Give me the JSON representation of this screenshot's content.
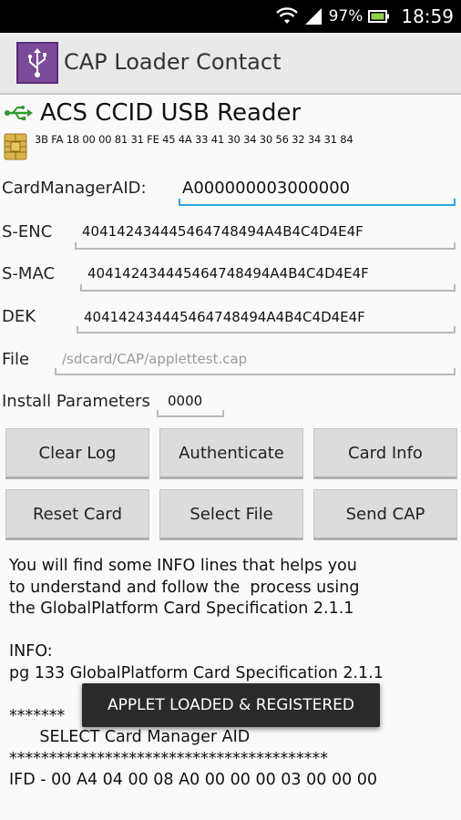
{
  "status_bar": {
    "battery_percent": "97%",
    "time": "18:59"
  },
  "app": {
    "title": "CAP Loader Contact"
  },
  "reader": {
    "name": "ACS CCID USB Reader",
    "atr": "3B FA 18 00 00 81 31 FE 45 4A 33 41 30 34 30 56 32 34 31 84"
  },
  "fields": {
    "card_manager_aid": {
      "label": "CardManagerAID:",
      "value": "A000000003000000"
    },
    "s_enc": {
      "label": "S-ENC",
      "value": "404142434445464748494A4B4C4D4E4F"
    },
    "s_mac": {
      "label": "S-MAC",
      "value": "404142434445464748494A4B4C4D4E4F"
    },
    "dek": {
      "label": "DEK",
      "value": "404142434445464748494A4B4C4D4E4F"
    },
    "file": {
      "label": "File",
      "placeholder": "/sdcard/CAP/applettest.cap"
    },
    "install_parameters": {
      "label": "Install Parameters",
      "value": "0000"
    }
  },
  "buttons": {
    "clear_log": "Clear Log",
    "authenticate": "Authenticate",
    "card_info": "Card Info",
    "reset_card": "Reset Card",
    "select_file": "Select File",
    "send_cap": "Send CAP"
  },
  "log": {
    "lines": [
      "You will find some INFO lines that helps you",
      "to understand and follow the  process using",
      "the GlobalPlatform Card Specification 2.1.1",
      "",
      "INFO:",
      "pg 133 GlobalPlatform Card Specification 2.1.1",
      "",
      "*******",
      "      SELECT Card Manager AID",
      "****************************************",
      "IFD - 00 A4 04 00 08 A0 00 00 00 03 00 00 00"
    ]
  },
  "toast": {
    "message": "APPLET LOADED & REGISTERED"
  }
}
